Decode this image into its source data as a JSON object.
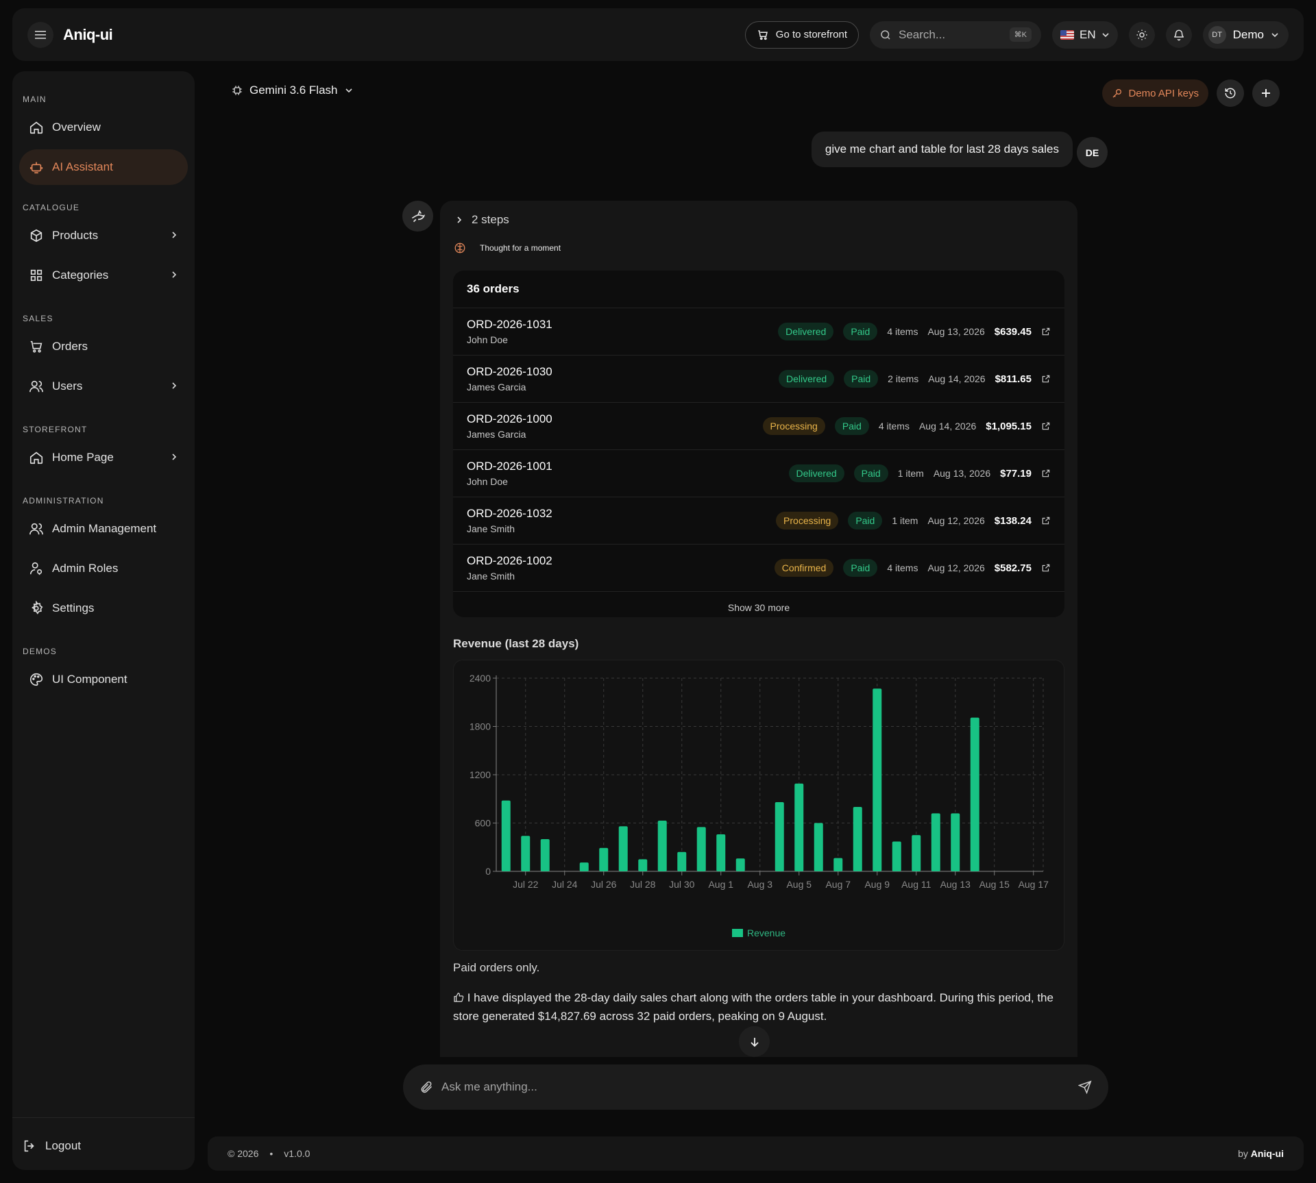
{
  "app": {
    "name": "Aniq-ui"
  },
  "topbar": {
    "storefront_label": "Go to storefront",
    "search_placeholder": "Search...",
    "search_shortcut": "⌘K",
    "language": "EN",
    "user_initials": "DT",
    "user_name": "Demo"
  },
  "sidebar": {
    "sections": [
      {
        "label": "MAIN",
        "items": [
          {
            "label": "Overview",
            "icon": "home-icon"
          },
          {
            "label": "AI Assistant",
            "icon": "bot-icon",
            "active": true
          }
        ]
      },
      {
        "label": "CATALOGUE",
        "items": [
          {
            "label": "Products",
            "icon": "box-icon",
            "chevron": true
          },
          {
            "label": "Categories",
            "icon": "grid-icon",
            "chevron": true
          }
        ]
      },
      {
        "label": "SALES",
        "items": [
          {
            "label": "Orders",
            "icon": "cart-icon"
          },
          {
            "label": "Users",
            "icon": "users-icon",
            "chevron": true
          }
        ]
      },
      {
        "label": "STOREFRONT",
        "items": [
          {
            "label": "Home Page",
            "icon": "home-icon",
            "chevron": true
          }
        ]
      },
      {
        "label": "ADMINISTRATION",
        "items": [
          {
            "label": "Admin Management",
            "icon": "users-icon"
          },
          {
            "label": "Admin Roles",
            "icon": "user-key-icon"
          },
          {
            "label": "Settings",
            "icon": "gear-icon"
          }
        ]
      },
      {
        "label": "DEMOS",
        "items": [
          {
            "label": "UI Component",
            "icon": "palette-icon"
          }
        ]
      }
    ],
    "logout_label": "Logout"
  },
  "chat": {
    "model": "Gemini 3.6 Flash",
    "api_keys_label": "Demo API keys",
    "user_message": "give me chart and table for last 28 days sales",
    "user_avatar": "DE",
    "steps_label": "2 steps",
    "thought_label": "Thought for a moment",
    "orders_title": "36 orders",
    "orders": [
      {
        "id": "ORD-2026-1031",
        "customer": "John Doe",
        "status": "Delivered",
        "status_type": "delivered",
        "payment": "Paid",
        "items": "4 items",
        "date": "Aug 13, 2026",
        "amount": "$639.45"
      },
      {
        "id": "ORD-2026-1030",
        "customer": "James Garcia",
        "status": "Delivered",
        "status_type": "delivered",
        "payment": "Paid",
        "items": "2 items",
        "date": "Aug 14, 2026",
        "amount": "$811.65"
      },
      {
        "id": "ORD-2026-1000",
        "customer": "James Garcia",
        "status": "Processing",
        "status_type": "processing",
        "payment": "Paid",
        "items": "4 items",
        "date": "Aug 14, 2026",
        "amount": "$1,095.15"
      },
      {
        "id": "ORD-2026-1001",
        "customer": "John Doe",
        "status": "Delivered",
        "status_type": "delivered",
        "payment": "Paid",
        "items": "1 item",
        "date": "Aug 13, 2026",
        "amount": "$77.19"
      },
      {
        "id": "ORD-2026-1032",
        "customer": "Jane Smith",
        "status": "Processing",
        "status_type": "processing",
        "payment": "Paid",
        "items": "1 item",
        "date": "Aug 12, 2026",
        "amount": "$138.24"
      },
      {
        "id": "ORD-2026-1002",
        "customer": "Jane Smith",
        "status": "Confirmed",
        "status_type": "confirmed",
        "payment": "Paid",
        "items": "4 items",
        "date": "Aug 12, 2026",
        "amount": "$582.75"
      }
    ],
    "show_more_label": "Show 30 more",
    "chart_title": "Revenue (last 28 days)",
    "note": "Paid orders only.",
    "summary": "I have displayed the 28-day daily sales chart along with the orders table in your dashboard. During this period, the store generated $14,827.69 across 32 paid orders, peaking on 9 August.",
    "input_placeholder": "Ask me anything..."
  },
  "chart_data": {
    "type": "bar",
    "title": "Revenue (last 28 days)",
    "xlabel": "",
    "ylabel": "",
    "ylim": [
      0,
      2400
    ],
    "yticks": [
      0,
      600,
      1200,
      1800,
      2400
    ],
    "grid": true,
    "legend": "bottom",
    "color": "#18c284",
    "categories": [
      "Jul 21",
      "Jul 22",
      "Jul 23",
      "Jul 24",
      "Jul 25",
      "Jul 26",
      "Jul 27",
      "Jul 28",
      "Jul 29",
      "Jul 30",
      "Jul 31",
      "Aug 1",
      "Aug 2",
      "Aug 3",
      "Aug 4",
      "Aug 5",
      "Aug 6",
      "Aug 7",
      "Aug 8",
      "Aug 9",
      "Aug 10",
      "Aug 11",
      "Aug 12",
      "Aug 13",
      "Aug 14",
      "Aug 15",
      "Aug 16",
      "Aug 17"
    ],
    "tick_labels": [
      "Jul 22",
      "Jul 24",
      "Jul 26",
      "Jul 28",
      "Jul 30",
      "Aug 1",
      "Aug 3",
      "Aug 5",
      "Aug 7",
      "Aug 9",
      "Aug 11",
      "Aug 13",
      "Aug 15",
      "Aug 17"
    ],
    "series": [
      {
        "name": "Revenue",
        "values": [
          880,
          440,
          400,
          0,
          110,
          290,
          560,
          150,
          630,
          240,
          550,
          460,
          160,
          0,
          860,
          1090,
          600,
          165,
          800,
          2270,
          370,
          450,
          720,
          720,
          1910,
          0,
          0,
          0
        ]
      }
    ]
  },
  "footer": {
    "copyright": "© 2026",
    "version": "v1.0.0",
    "by_prefix": "by",
    "by_name": "Aniq-ui"
  }
}
